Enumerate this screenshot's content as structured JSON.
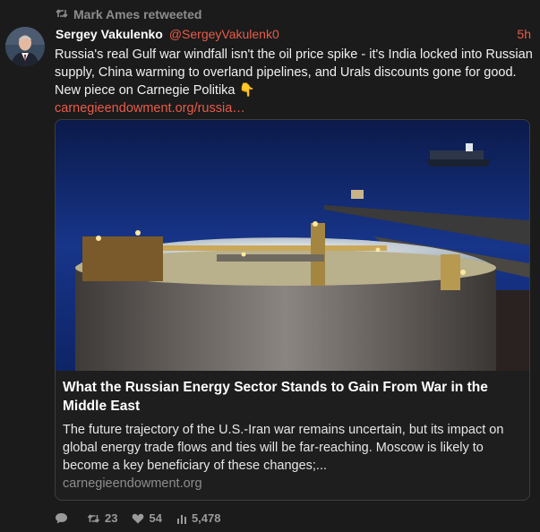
{
  "retweet": {
    "label": "Mark Ames retweeted",
    "icon": "retweet-icon"
  },
  "tweet": {
    "display_name": "Sergey Vakulenko",
    "handle": "@SergeyVakulenk0",
    "time": "5h",
    "text": "Russia's real Gulf war windfall isn't the oil price spike - it's India locked into Russian supply, China warming to overland pipelines, and Urals discounts gone for good. New piece on Carnegie Politika",
    "emoji": "👇",
    "link": "carnegieendowment.org/russia…"
  },
  "card": {
    "title": "What the Russian Energy Sector Stands to Gain From War in the Middle East",
    "description": "The future trajectory of the U.S.-Iran war remains uncertain, but its impact on global energy trade flows and ties will be far-reaching. Moscow is likely to become a key beneficiary of these changes;...",
    "domain": "carnegieendowment.org"
  },
  "actions": {
    "reply": "",
    "retweets": "23",
    "likes": "54",
    "views": "5,478"
  },
  "colors": {
    "accent": "#e85b4a",
    "muted": "#8d8d8d",
    "background": "#1b1b1b"
  }
}
